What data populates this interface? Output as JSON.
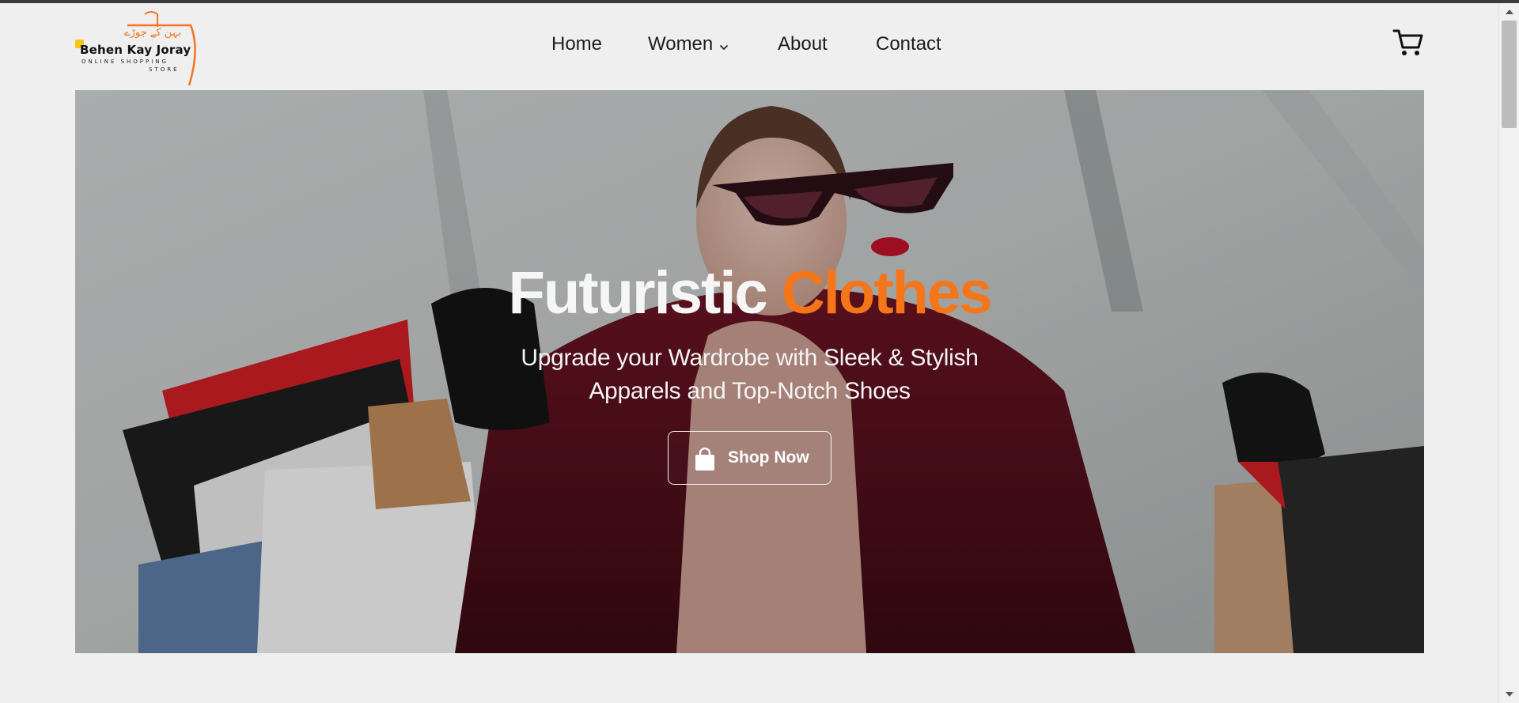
{
  "brand": {
    "name": "Behen Kay Joray",
    "tagline_line1": "ONLINE SHOPPING",
    "tagline_line2": "STORE",
    "urdu_name": "بہن کے جوڑے",
    "accent_color": "#f5761a"
  },
  "nav": {
    "items": [
      {
        "label": "Home"
      },
      {
        "label": "Women",
        "has_dropdown": true,
        "dropdown_icon": "chevron-down-icon"
      },
      {
        "label": "About"
      },
      {
        "label": "Contact"
      }
    ],
    "cart_icon": "cart-icon"
  },
  "hero": {
    "title_part1": "Futuristic",
    "title_part2": "Clothes",
    "subtitle_line1": "Upgrade your Wardrobe with Sleek & Stylish",
    "subtitle_line2": "Apparels and Top-Notch Shoes",
    "button_label": "Shop Now",
    "button_icon": "shopping-bag-icon"
  }
}
